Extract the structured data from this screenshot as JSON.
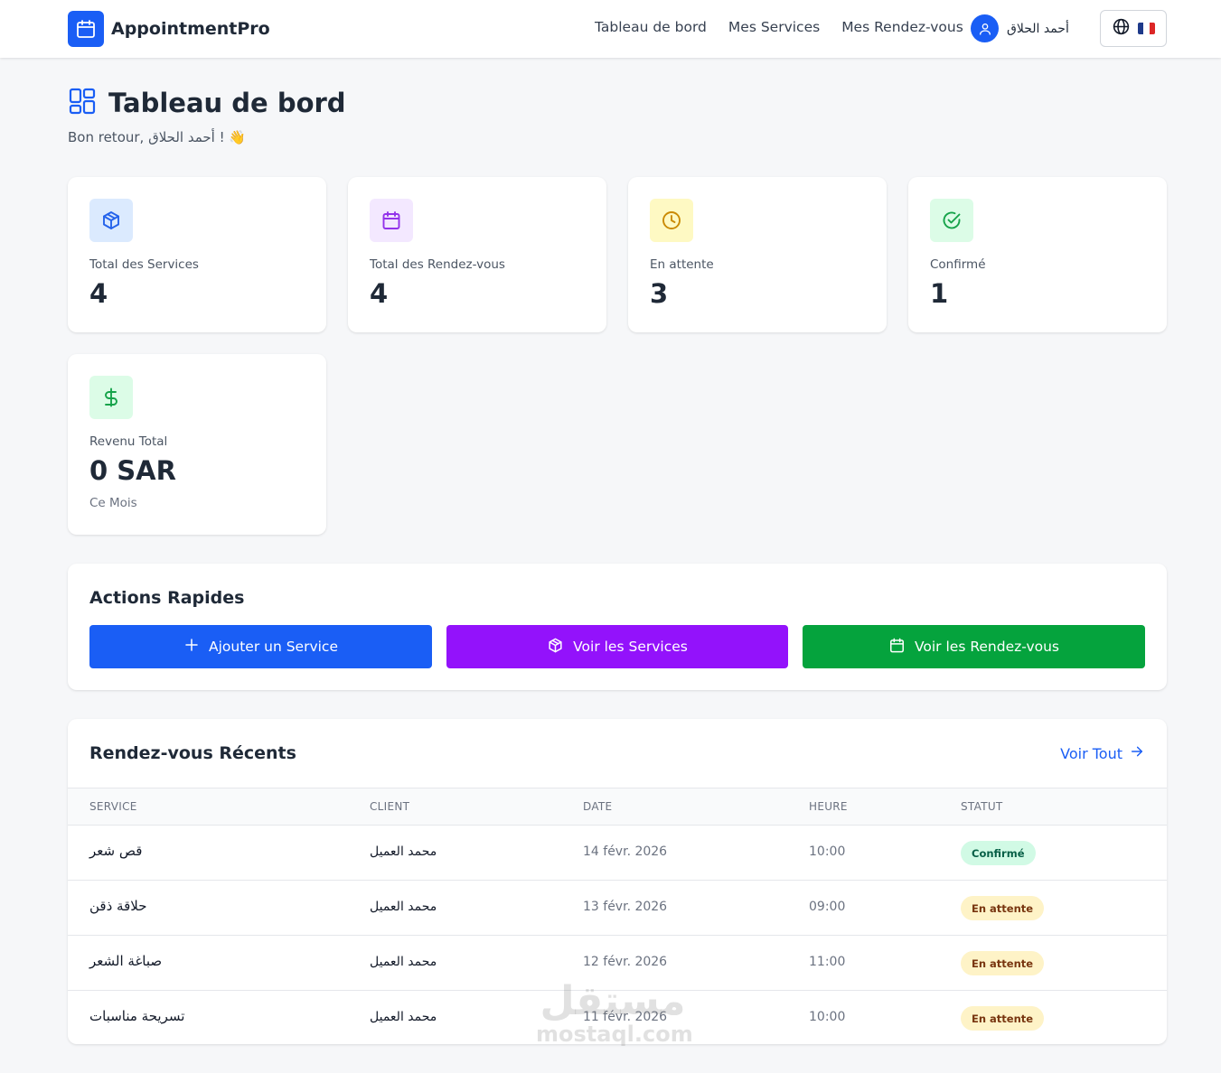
{
  "navbar": {
    "brand": "AppointmentPro",
    "links": [
      "Tableau de bord",
      "Mes Services",
      "Mes Rendez-vous"
    ],
    "user_name": "أحمد الحلاق"
  },
  "header": {
    "title": "Tableau de bord",
    "subtitle": "Bon retour, أحمد الحلاق ! 👋"
  },
  "stats": [
    {
      "label": "Total des Services",
      "value": "4",
      "icon": "package-icon",
      "color": "#2563eb",
      "bg": "#dbeafe"
    },
    {
      "label": "Total des Rendez-vous",
      "value": "4",
      "icon": "calendar-icon",
      "color": "#9333ea",
      "bg": "#f3e8ff"
    },
    {
      "label": "En attente",
      "value": "3",
      "icon": "clock-icon",
      "color": "#ca8a04",
      "bg": "#fef9c3"
    },
    {
      "label": "Confirmé",
      "value": "1",
      "icon": "check-circle-icon",
      "color": "#16a34a",
      "bg": "#dcfce7"
    }
  ],
  "revenue": {
    "label": "Revenu Total",
    "value": "0 SAR",
    "sub": "Ce Mois",
    "icon": "dollar-icon",
    "color": "#16a34a",
    "bg": "#dcfce7"
  },
  "quick_actions": {
    "title": "Actions Rapides",
    "buttons": [
      {
        "label": "Ajouter un Service",
        "icon": "plus-icon",
        "color": "#1a5ef5"
      },
      {
        "label": "Voir les Services",
        "icon": "package-icon",
        "color": "#9312fb"
      },
      {
        "label": "Voir les Rendez-vous",
        "icon": "calendar-icon",
        "color": "#05a33d"
      }
    ]
  },
  "recent": {
    "title": "Rendez-vous Récents",
    "view_all": "Voir Tout",
    "columns": [
      "SERVICE",
      "CLIENT",
      "DATE",
      "HEURE",
      "STATUT"
    ],
    "rows": [
      {
        "service": "قص شعر",
        "client": "محمد العميل",
        "date": "14 févr. 2026",
        "time": "10:00",
        "status": "Confirmé",
        "status_type": "confirmed"
      },
      {
        "service": "حلاقة ذقن",
        "client": "محمد العميل",
        "date": "13 févr. 2026",
        "time": "09:00",
        "status": "En attente",
        "status_type": "pending"
      },
      {
        "service": "صباغة الشعر",
        "client": "محمد العميل",
        "date": "12 févr. 2026",
        "time": "11:00",
        "status": "En attente",
        "status_type": "pending"
      },
      {
        "service": "تسريحة مناسبات",
        "client": "محمد العميل",
        "date": "11 févr. 2026",
        "time": "10:00",
        "status": "En attente",
        "status_type": "pending"
      }
    ]
  },
  "watermark": {
    "ar": "مستقل",
    "lat": "mostaql.com"
  }
}
